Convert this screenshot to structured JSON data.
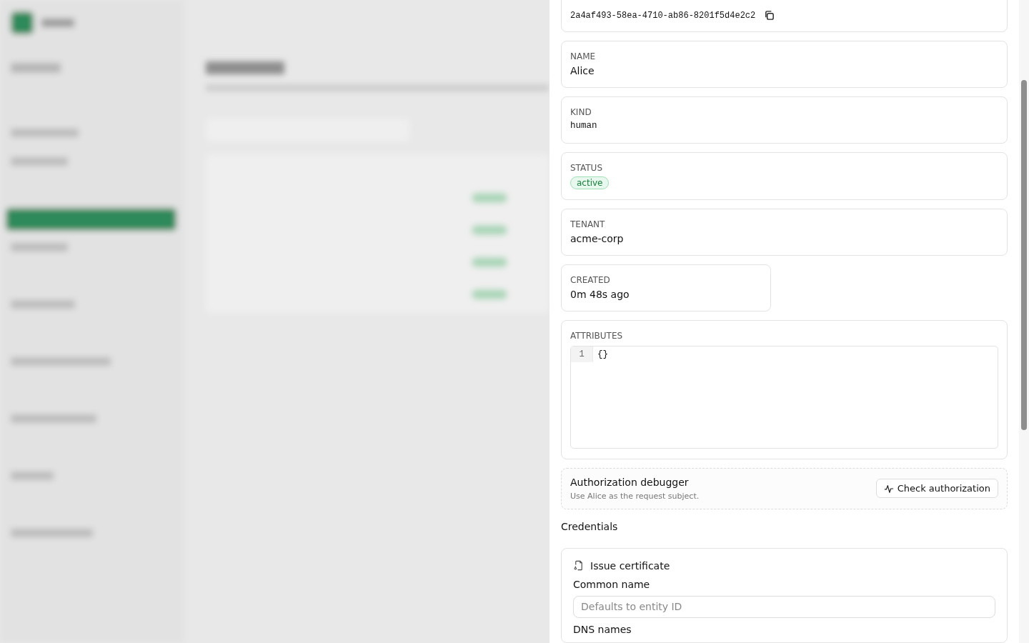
{
  "detail": {
    "id_value": "2a4af493-58ea-4710-ab86-8201f5d4e2c2",
    "fields": [
      {
        "label": "NAME",
        "value": "Alice",
        "kind": "text"
      },
      {
        "label": "KIND",
        "value": "human",
        "kind": "mono"
      },
      {
        "label": "STATUS",
        "value": "active",
        "kind": "badge"
      },
      {
        "label": "TENANT",
        "value": "acme-corp",
        "kind": "text"
      }
    ],
    "created": {
      "label": "CREATED",
      "value": "0m 48s ago"
    },
    "attributes": {
      "label": "ATTRIBUTES",
      "lines": [
        {
          "number": "1",
          "code": "{}"
        }
      ]
    },
    "debugger": {
      "title": "Authorization debugger",
      "subtitle": "Use Alice as the request subject.",
      "button": "Check authorization"
    },
    "credentials": {
      "heading": "Credentials",
      "card_title": "Issue certificate",
      "common_name_label": "Common name",
      "common_name_placeholder": "Defaults to entity ID",
      "dns_label": "DNS names"
    }
  }
}
